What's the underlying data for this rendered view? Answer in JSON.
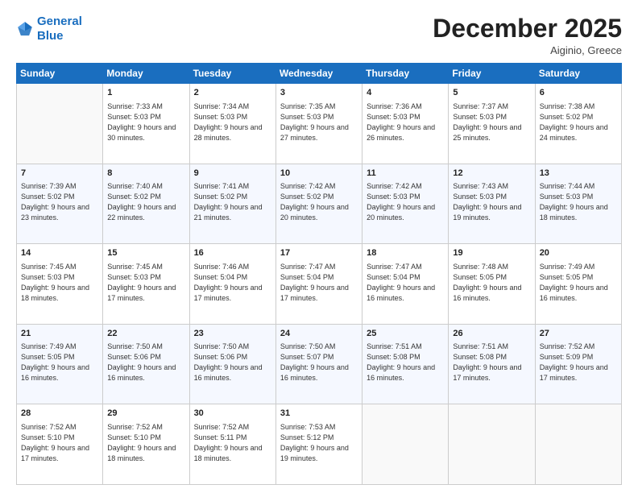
{
  "header": {
    "logo_line1": "General",
    "logo_line2": "Blue",
    "title": "December 2025",
    "location": "Aiginio, Greece"
  },
  "columns": [
    "Sunday",
    "Monday",
    "Tuesday",
    "Wednesday",
    "Thursday",
    "Friday",
    "Saturday"
  ],
  "weeks": [
    [
      {
        "day": "",
        "info": ""
      },
      {
        "day": "1",
        "info": "Sunrise: 7:33 AM\nSunset: 5:03 PM\nDaylight: 9 hours\nand 30 minutes."
      },
      {
        "day": "2",
        "info": "Sunrise: 7:34 AM\nSunset: 5:03 PM\nDaylight: 9 hours\nand 28 minutes."
      },
      {
        "day": "3",
        "info": "Sunrise: 7:35 AM\nSunset: 5:03 PM\nDaylight: 9 hours\nand 27 minutes."
      },
      {
        "day": "4",
        "info": "Sunrise: 7:36 AM\nSunset: 5:03 PM\nDaylight: 9 hours\nand 26 minutes."
      },
      {
        "day": "5",
        "info": "Sunrise: 7:37 AM\nSunset: 5:03 PM\nDaylight: 9 hours\nand 25 minutes."
      },
      {
        "day": "6",
        "info": "Sunrise: 7:38 AM\nSunset: 5:02 PM\nDaylight: 9 hours\nand 24 minutes."
      }
    ],
    [
      {
        "day": "7",
        "info": "Sunrise: 7:39 AM\nSunset: 5:02 PM\nDaylight: 9 hours\nand 23 minutes."
      },
      {
        "day": "8",
        "info": "Sunrise: 7:40 AM\nSunset: 5:02 PM\nDaylight: 9 hours\nand 22 minutes."
      },
      {
        "day": "9",
        "info": "Sunrise: 7:41 AM\nSunset: 5:02 PM\nDaylight: 9 hours\nand 21 minutes."
      },
      {
        "day": "10",
        "info": "Sunrise: 7:42 AM\nSunset: 5:02 PM\nDaylight: 9 hours\nand 20 minutes."
      },
      {
        "day": "11",
        "info": "Sunrise: 7:42 AM\nSunset: 5:03 PM\nDaylight: 9 hours\nand 20 minutes."
      },
      {
        "day": "12",
        "info": "Sunrise: 7:43 AM\nSunset: 5:03 PM\nDaylight: 9 hours\nand 19 minutes."
      },
      {
        "day": "13",
        "info": "Sunrise: 7:44 AM\nSunset: 5:03 PM\nDaylight: 9 hours\nand 18 minutes."
      }
    ],
    [
      {
        "day": "14",
        "info": "Sunrise: 7:45 AM\nSunset: 5:03 PM\nDaylight: 9 hours\nand 18 minutes."
      },
      {
        "day": "15",
        "info": "Sunrise: 7:45 AM\nSunset: 5:03 PM\nDaylight: 9 hours\nand 17 minutes."
      },
      {
        "day": "16",
        "info": "Sunrise: 7:46 AM\nSunset: 5:04 PM\nDaylight: 9 hours\nand 17 minutes."
      },
      {
        "day": "17",
        "info": "Sunrise: 7:47 AM\nSunset: 5:04 PM\nDaylight: 9 hours\nand 17 minutes."
      },
      {
        "day": "18",
        "info": "Sunrise: 7:47 AM\nSunset: 5:04 PM\nDaylight: 9 hours\nand 16 minutes."
      },
      {
        "day": "19",
        "info": "Sunrise: 7:48 AM\nSunset: 5:05 PM\nDaylight: 9 hours\nand 16 minutes."
      },
      {
        "day": "20",
        "info": "Sunrise: 7:49 AM\nSunset: 5:05 PM\nDaylight: 9 hours\nand 16 minutes."
      }
    ],
    [
      {
        "day": "21",
        "info": "Sunrise: 7:49 AM\nSunset: 5:05 PM\nDaylight: 9 hours\nand 16 minutes."
      },
      {
        "day": "22",
        "info": "Sunrise: 7:50 AM\nSunset: 5:06 PM\nDaylight: 9 hours\nand 16 minutes."
      },
      {
        "day": "23",
        "info": "Sunrise: 7:50 AM\nSunset: 5:06 PM\nDaylight: 9 hours\nand 16 minutes."
      },
      {
        "day": "24",
        "info": "Sunrise: 7:50 AM\nSunset: 5:07 PM\nDaylight: 9 hours\nand 16 minutes."
      },
      {
        "day": "25",
        "info": "Sunrise: 7:51 AM\nSunset: 5:08 PM\nDaylight: 9 hours\nand 16 minutes."
      },
      {
        "day": "26",
        "info": "Sunrise: 7:51 AM\nSunset: 5:08 PM\nDaylight: 9 hours\nand 17 minutes."
      },
      {
        "day": "27",
        "info": "Sunrise: 7:52 AM\nSunset: 5:09 PM\nDaylight: 9 hours\nand 17 minutes."
      }
    ],
    [
      {
        "day": "28",
        "info": "Sunrise: 7:52 AM\nSunset: 5:10 PM\nDaylight: 9 hours\nand 17 minutes."
      },
      {
        "day": "29",
        "info": "Sunrise: 7:52 AM\nSunset: 5:10 PM\nDaylight: 9 hours\nand 18 minutes."
      },
      {
        "day": "30",
        "info": "Sunrise: 7:52 AM\nSunset: 5:11 PM\nDaylight: 9 hours\nand 18 minutes."
      },
      {
        "day": "31",
        "info": "Sunrise: 7:53 AM\nSunset: 5:12 PM\nDaylight: 9 hours\nand 19 minutes."
      },
      {
        "day": "",
        "info": ""
      },
      {
        "day": "",
        "info": ""
      },
      {
        "day": "",
        "info": ""
      }
    ]
  ]
}
